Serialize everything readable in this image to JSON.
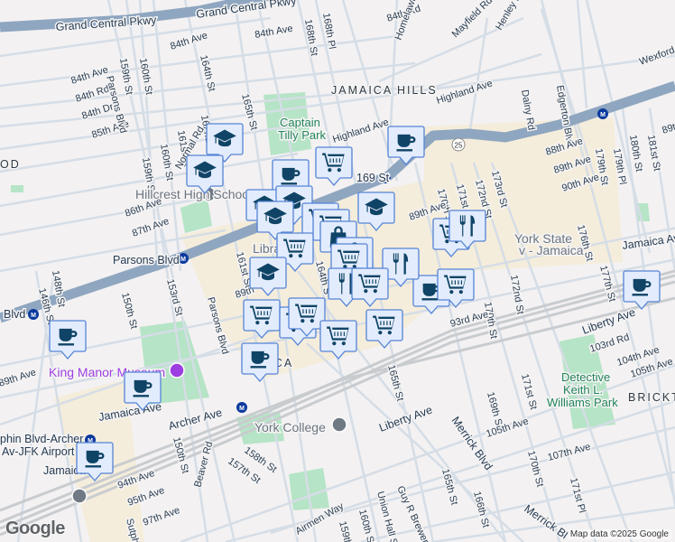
{
  "colors": {
    "background": "#f3f1f2",
    "highway": "#8fa6c0",
    "street": "#d5dde6",
    "rail": "#c9cccf",
    "park": "#b6e4c6",
    "commercial": "#f5eddb",
    "marker_fill": "#e3ecfd",
    "marker_stroke": "#5584d6",
    "marker_icon": "#0f4466"
  },
  "labels": {
    "gcp1": "Grand Central Pkwy",
    "gcp2": "Grand Central Pkwy",
    "s164a": "164th St",
    "a84a": "84th Ave",
    "a84b": "84th Ave",
    "a84c": "84th Ave",
    "r84": "84th Rd",
    "d84": "84th Dr",
    "a85": "85th Ave",
    "parsons1": "Parsons Blvd",
    "s159a": "159th St",
    "s160a": "160th St",
    "s165a": "165th St",
    "s162": "162nd St",
    "s161a": "161st St",
    "s160b": "160th St",
    "s159b": "159th St",
    "normal": "Normal Rd",
    "jh": "JAMAICA HILLS",
    "tilly1": "Captain",
    "tilly2": "Tilly Park",
    "hillcrest": "Hillcrest High School",
    "a86": "86th Ave",
    "a87": "87th Ave",
    "parsons2": "Parsons Blvd",
    "s148": "148th St",
    "s168": "168th St",
    "p168": "168th Pl",
    "r84b": "84th Rd",
    "homelawn": "Homelawn St",
    "mayfield": "Mayfield Rd",
    "henley": "Henley Rd",
    "dalny": "Dalny Rd",
    "edgerton": "Edgerton Blvd",
    "wexford": "Wexford Ter",
    "highland1": "Highland Ave",
    "highland2": "Highland Ave",
    "st169": "169 St",
    "s179": "179th St",
    "p179": "179th Pl",
    "s180": "180th St",
    "s181": "181st St",
    "a89r": "89t",
    "s170a": "170th St",
    "s171a": "171st St",
    "s172a": "172nd St",
    "s173": "173rd St",
    "a88": "88th Ave",
    "a89a": "89th Ave",
    "a90": "90th Ave",
    "s176": "176th St",
    "jamaica1": "Jamaica Ave",
    "a89b": "89th Ave",
    "ys1": "York State",
    "ys2": "v - Jamaica",
    "s177": "177th St",
    "s172b": "172nd St",
    "s170b": "170th St",
    "a93": "93rd Ave",
    "liberty1": "Liberty Ave",
    "r103": "103rd Rd",
    "a104": "104th Ave",
    "a105a": "105th Ave",
    "brickton": "BRICKTO",
    "dk1": "Detective",
    "dk2": "Keith L.",
    "dk3": "Williams Park",
    "s171b": "171st St",
    "s169": "169th St",
    "a105b": "105th Ave",
    "a107": "107th Ave",
    "s170c": "170th St",
    "p171": "171st Pl",
    "merrick1": "Merrick Blvd",
    "merrick2": "Merrick Bl",
    "s165b": "165th St",
    "liberty2": "Liberty Ave",
    "s165c": "165th St",
    "s166": "166th St",
    "guy": "Guy R Brewer",
    "union": "Union Hall St",
    "s160c": "160th St",
    "s159c": "159th St",
    "a89c": "89th Ave",
    "blvd": "Blvd",
    "s146": "146th St",
    "s150a": "150th St",
    "s153": "153rd St",
    "parsons3": "Parsons Blvd",
    "a89d": "89th",
    "kingmanor": "King Manor Museum",
    "aica": "AICA",
    "jamaica2": "Jamaica Ave",
    "archer": "Archer Ave",
    "york": "York College",
    "s150b": "150th St",
    "s158": "158th St",
    "s157": "157th St",
    "beaver": "Beaver Rd",
    "a94": "94th Ave",
    "a95": "95th Ave",
    "a97": "97th Ave",
    "airmen": "Airmen Way",
    "sutph": "Sutph",
    "sutph1": "phin Blvd-Archer",
    "sutph2": "Av-JFK Airport",
    "jamaicaStn": "Jamaica",
    "libra": "Libra",
    "s161b": "161st St",
    "s164b": "164th S",
    "parsons_stn": "Parsons Blvd",
    "od": "OD",
    "hwy25": "25"
  },
  "markers": [
    "cap",
    "cap",
    "coffee",
    "cart",
    "coffee",
    "cap",
    "cap",
    "cap",
    "cap",
    "cart",
    "cart",
    "bag",
    "bag",
    "cart",
    "cart",
    "cart",
    "coffee",
    "fork",
    "fork",
    "fork",
    "cart",
    "cart",
    "cap",
    "cart",
    "cart",
    "cart",
    "cart",
    "cart",
    "coffee",
    "coffee",
    "coffee",
    "coffee",
    "coffee"
  ],
  "attribution": "Map data ©2025 Google",
  "logo": "Google"
}
